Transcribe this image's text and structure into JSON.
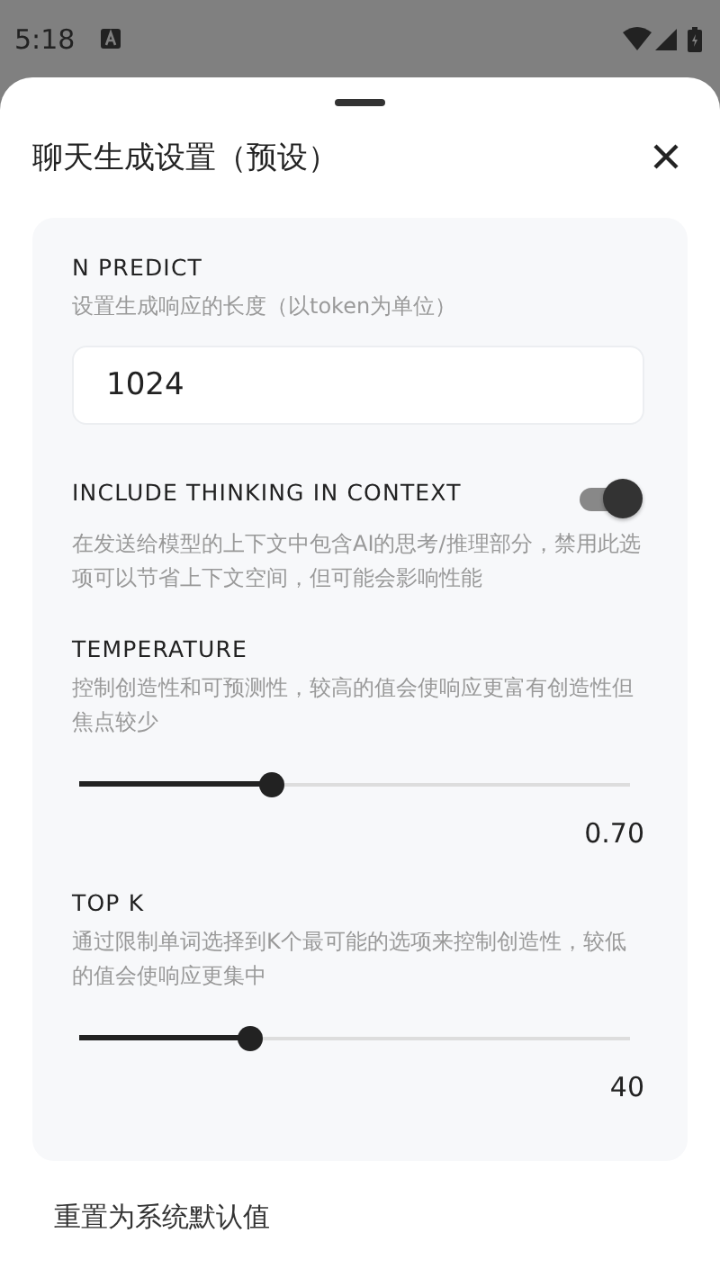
{
  "status_bar": {
    "time": "5:18"
  },
  "sheet": {
    "title": "聊天生成设置（预设）"
  },
  "settings": [
    {
      "kind": "number",
      "label": "N PREDICT",
      "description": "设置生成响应的长度（以token为单位）",
      "value": "1024"
    },
    {
      "kind": "toggle",
      "label": "INCLUDE THINKING IN CONTEXT",
      "description": "在发送给模型的上下文中包含AI的思考/推理部分，禁用此选项可以节省上下文空间，但可能会影响性能",
      "on": true
    },
    {
      "kind": "slider",
      "label": "TEMPERATURE",
      "description": "控制创造性和可预测性，较高的值会使响应更富有创造性但焦点较少",
      "level": 0.35,
      "reading": "0.70"
    },
    {
      "kind": "slider",
      "label": "TOP K",
      "description": "通过限制单词选择到K个最可能的选项来控制创造性，较低的值会使响应更集中",
      "level": 0.31,
      "reading": "40"
    }
  ],
  "footer": {
    "reset_button": "重置为系统默认值"
  }
}
